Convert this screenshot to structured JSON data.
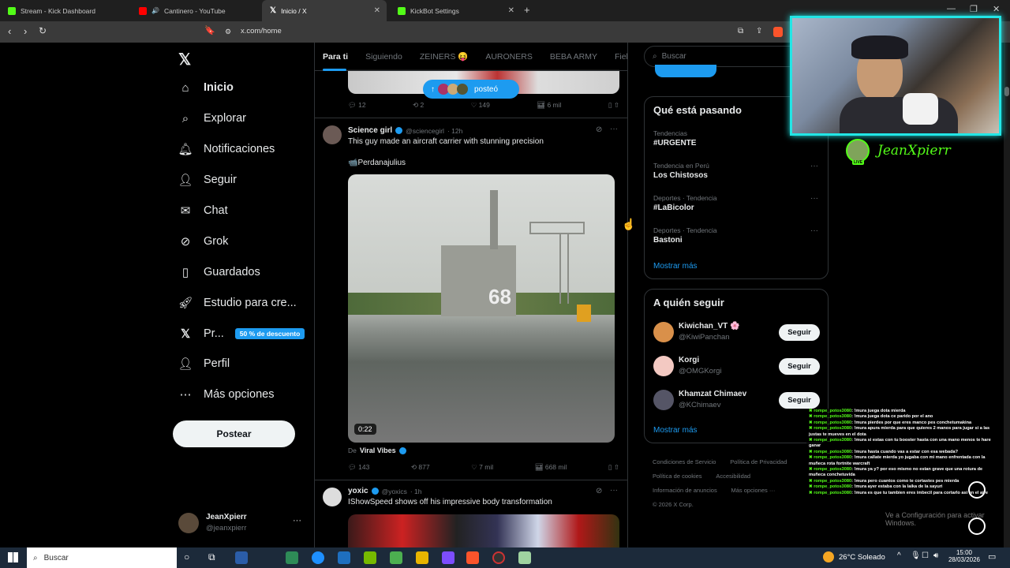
{
  "browser": {
    "tabs": [
      {
        "label": "Stream - Kick Dashboard"
      },
      {
        "label": "Cantinero - YouTube"
      },
      {
        "label": "Inicio / X"
      },
      {
        "label": "KickBot Settings"
      }
    ],
    "url": "x.com/home"
  },
  "nav": {
    "items": [
      {
        "label": "Inicio",
        "icon": "home-icon"
      },
      {
        "label": "Explorar",
        "icon": "search-icon"
      },
      {
        "label": "Notificaciones",
        "icon": "bell-icon"
      },
      {
        "label": "Seguir",
        "icon": "person-add-icon"
      },
      {
        "label": "Chat",
        "icon": "mail-icon"
      },
      {
        "label": "Grok",
        "icon": "grok-icon"
      },
      {
        "label": "Guardados",
        "icon": "bookmark-icon"
      },
      {
        "label": "Estudio para cre...",
        "icon": "rocket-icon"
      },
      {
        "label": "Pr...",
        "icon": "x-icon"
      },
      {
        "label": "Perfil",
        "icon": "person-icon"
      },
      {
        "label": "Más opciones",
        "icon": "more-icon"
      }
    ],
    "premium_badge": "50 % de descuento",
    "post_label": "Postear",
    "account": {
      "name": "JeanXpierr",
      "handle": "@jeanxpierr"
    }
  },
  "feed": {
    "tabs": [
      "Para ti",
      "Siguiendo",
      "ZEINERS 😝",
      "AURONERS",
      "BEBA ARMY",
      "Fiel Arm"
    ],
    "new_posts_label": "posteó",
    "top_tweet_stats": {
      "replies": "12",
      "reposts": "2",
      "likes": "149",
      "views": "6 mil"
    },
    "tweet1": {
      "name": "Science girl",
      "handle": "@sciencegirl",
      "time": "· 12h",
      "text": "This guy made an aircraft carrier with stunning precision",
      "credit": "📹Perdanajulius",
      "video_duration": "0:22",
      "hull_number": "68",
      "from_prefix": "De",
      "from_name": "Viral Vibes",
      "stats": {
        "replies": "143",
        "reposts": "877",
        "likes": "7 mil",
        "views": "668 mil"
      }
    },
    "tweet2": {
      "name": "yoxic",
      "handle": "@yoxics",
      "time": "· 1h",
      "text": "IShowSpeed shows off his impressive body transformation"
    }
  },
  "sidebar": {
    "search_placeholder": "Buscar",
    "trends_title": "Qué está pasando",
    "trends": [
      {
        "category": "Tendencias",
        "name": "#URGENTE"
      },
      {
        "category": "Tendencia en Perú",
        "name": "Los Chistosos"
      },
      {
        "category": "Deportes · Tendencia",
        "name": "#LaBicolor"
      },
      {
        "category": "Deportes · Tendencia",
        "name": "Bastoni"
      }
    ],
    "show_more": "Mostrar más",
    "follow_title": "A quién seguir",
    "follow": [
      {
        "name": "Kiwichan_VT 🌸",
        "handle": "@KiwiPanchan",
        "button": "Seguir"
      },
      {
        "name": "Korgi",
        "handle": "@OMGKorgi",
        "button": "Seguir"
      },
      {
        "name": "Khamzat Chimaev",
        "handle": "@KChimaev",
        "button": "Seguir"
      }
    ],
    "footer": [
      "Condiciones de Servicio",
      "Política de Privacidad",
      "Política de cookies",
      "Accesibilidad",
      "Información de anuncios",
      "Más opciones ···",
      "© 2026 X Corp."
    ]
  },
  "stream_overlay": {
    "streamer_name": "JeanXpierr",
    "live_badge": "LIVE",
    "chat": [
      {
        "user": "rompe_potos3080",
        "msg": ": !mura juega dota mierda"
      },
      {
        "user": "rompe_potos3080",
        "msg": ": !mura juega dota ce parido por el ano"
      },
      {
        "user": "rompe_potos3080",
        "msg": ": !mura pierdes por que eres manco pes conchetumakina"
      },
      {
        "user": "rompe_potos3080",
        "msg": ": !mura apura mierda para que quieres 2 manos para jugar si a las justas te mueves en el dota"
      },
      {
        "user": "rompe_potos3080",
        "msg": ": !mura si estas con tu booster hasta con una mano menos te hare ganar"
      },
      {
        "user": "rompe_potos3080",
        "msg": ": !mura hasta cuando vas a estar con esa webada?"
      },
      {
        "user": "rompe_potos3080",
        "msg": ": !mura callate mierda yo jugaba con mi mano enfrentada con la muñeca rota fortnite warcraft"
      },
      {
        "user": "rompe_potos3080",
        "msg": ": !mura ya y? por eso mismo no estan grave que una rotura de muñeca conchetuvida"
      },
      {
        "user": "rompe_potos3080",
        "msg": ": !mura pero cuantos como te cortastes pes mierda"
      },
      {
        "user": "rompe_potos3080",
        "msg": ": !mura ayer estaba con la laika de la sayuri"
      },
      {
        "user": "rompe_potos3080",
        "msg": ": !mura es que tu tambien eres imbecil para cortarlo asi en el aire"
      }
    ],
    "windows_watermark": "Ve a Configuración para activar Windows."
  },
  "taskbar": {
    "search_label": "Buscar",
    "weather": "26°C  Soleado",
    "time": "15:00",
    "date": "28/03/2026"
  },
  "colors": {
    "accent": "#1d9bf0",
    "kick_green": "#53fc18",
    "bg": "#000000"
  }
}
